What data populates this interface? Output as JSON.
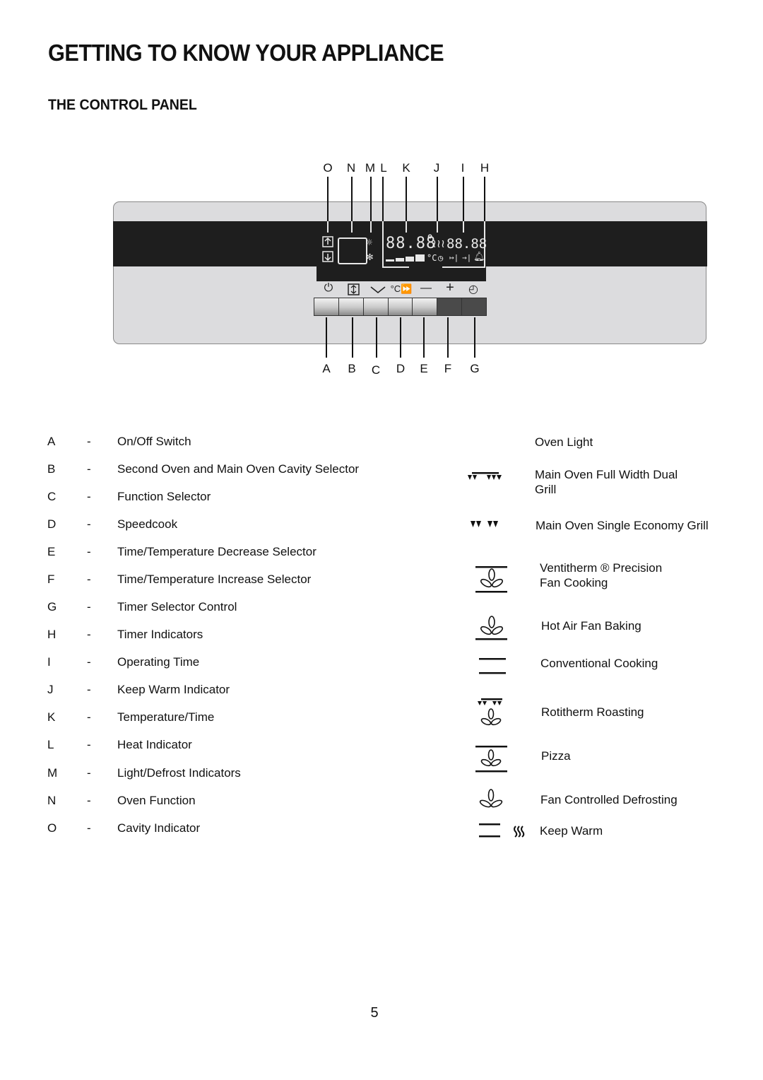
{
  "page": {
    "title": "GETTING TO KNOW YOUR APPLIANCE",
    "section_title": "THE CONTROL PANEL",
    "page_number": "5"
  },
  "diagram": {
    "top_callouts": [
      "O",
      "N",
      "M",
      "L",
      "K",
      "J",
      "I",
      "H"
    ],
    "bottom_callouts": [
      "A",
      "B",
      "C",
      "D",
      "E",
      "F",
      "G"
    ],
    "display": {
      "temperature_digits": "88.8̊8",
      "temperature_unit": "°C",
      "timer_digits": "88.88"
    },
    "buttons": [
      {
        "key": "A",
        "icon": "power-icon",
        "glyph": "⏀",
        "shade": "light"
      },
      {
        "key": "B",
        "icon": "cavity-selector-icon",
        "glyph": "⇕",
        "shade": "light"
      },
      {
        "key": "C",
        "icon": "chevron-down-icon",
        "glyph": "﹀",
        "shade": "light"
      },
      {
        "key": "D",
        "icon": "speedcook-icon",
        "glyph": "°C⏩",
        "shade": "light"
      },
      {
        "key": "E",
        "icon": "minus-icon",
        "glyph": "—",
        "shade": "light"
      },
      {
        "key": "F",
        "icon": "plus-icon",
        "glyph": "+",
        "shade": "dark"
      },
      {
        "key": "G",
        "icon": "timer-icon",
        "glyph": "◴",
        "shade": "dark"
      }
    ]
  },
  "controls_legend": [
    {
      "key": "A",
      "dash": "-",
      "description": "On/Off Switch"
    },
    {
      "key": "B",
      "dash": "-",
      "description": "Second Oven and Main Oven Cavity Selector"
    },
    {
      "key": "C",
      "dash": "-",
      "description": "Function Selector"
    },
    {
      "key": "D",
      "dash": "-",
      "description": "Speedcook"
    },
    {
      "key": "E",
      "dash": "-",
      "description": "Time/Temperature Decrease Selector"
    },
    {
      "key": "F",
      "dash": "-",
      "description": "Time/Temperature Increase Selector"
    },
    {
      "key": "G",
      "dash": "-",
      "description": "Timer Selector Control"
    },
    {
      "key": "H",
      "dash": "-",
      "description": "Timer Indicators"
    },
    {
      "key": "I",
      "dash": "-",
      "description": "Operating Time"
    },
    {
      "key": "J",
      "dash": "-",
      "description": "Keep Warm Indicator"
    },
    {
      "key": "K",
      "dash": "-",
      "description": "Temperature/Time"
    },
    {
      "key": "L",
      "dash": "-",
      "description": "Heat Indicator"
    },
    {
      "key": "M",
      "dash": "-",
      "description": "Light/Defrost Indicators"
    },
    {
      "key": "N",
      "dash": "-",
      "description": "Oven Function"
    },
    {
      "key": "O",
      "dash": "-",
      "description": "Cavity Indicator"
    }
  ],
  "functions_legend": [
    {
      "icon": "oven-light-icon",
      "line1": "Oven Light",
      "line2": ""
    },
    {
      "icon": "full-width-dual-grill-icon",
      "line1": "Main Oven Full Width Dual",
      "line2": "Grill"
    },
    {
      "icon": "single-economy-grill-icon",
      "line1": "Main Oven Single Economy Grill",
      "line2": ""
    },
    {
      "icon": "ventitherm-fan-icon",
      "line1": "Ventitherm ® Precision",
      "line2": "Fan Cooking"
    },
    {
      "icon": "hot-air-fan-icon",
      "line1": "Hot Air Fan Baking",
      "line2": ""
    },
    {
      "icon": "conventional-cooking-icon",
      "line1": "Conventional Cooking",
      "line2": ""
    },
    {
      "icon": "rotitherm-roasting-icon",
      "line1": "Rotitherm Roasting",
      "line2": ""
    },
    {
      "icon": "pizza-icon",
      "line1": "Pizza",
      "line2": ""
    },
    {
      "icon": "fan-defrost-icon",
      "line1": "Fan Controlled Defrosting",
      "line2": ""
    },
    {
      "icon": "keep-warm-icon",
      "line1": "Keep Warm",
      "line2": ""
    }
  ]
}
